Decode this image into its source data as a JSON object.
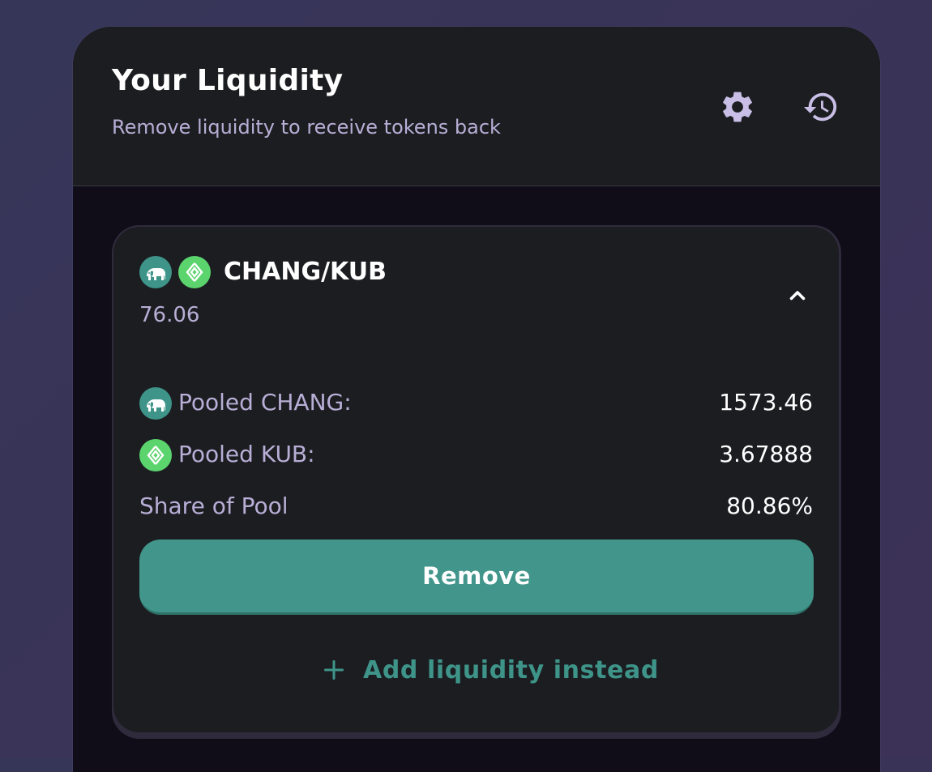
{
  "header": {
    "title": "Your Liquidity",
    "subtitle": "Remove liquidity to receive tokens back",
    "settings_icon": "gear-icon",
    "history_icon": "history-icon"
  },
  "position": {
    "token_a": "CHANG",
    "token_b": "KUB",
    "pair_name": "CHANG/KUB",
    "balance": "76.06",
    "expanded": true,
    "rows": {
      "pooled_a_label": "Pooled CHANG:",
      "pooled_a_value": "1573.46",
      "pooled_b_label": "Pooled KUB:",
      "pooled_b_value": "3.67888",
      "share_label": "Share of Pool",
      "share_value": "80.86%"
    },
    "remove_label": "Remove",
    "add_label": "Add liquidity instead"
  },
  "colors": {
    "accent": "#41958a",
    "chang_logo": "#3e9489",
    "kub_logo": "#5bd46e",
    "muted_text": "#b8aed6"
  }
}
